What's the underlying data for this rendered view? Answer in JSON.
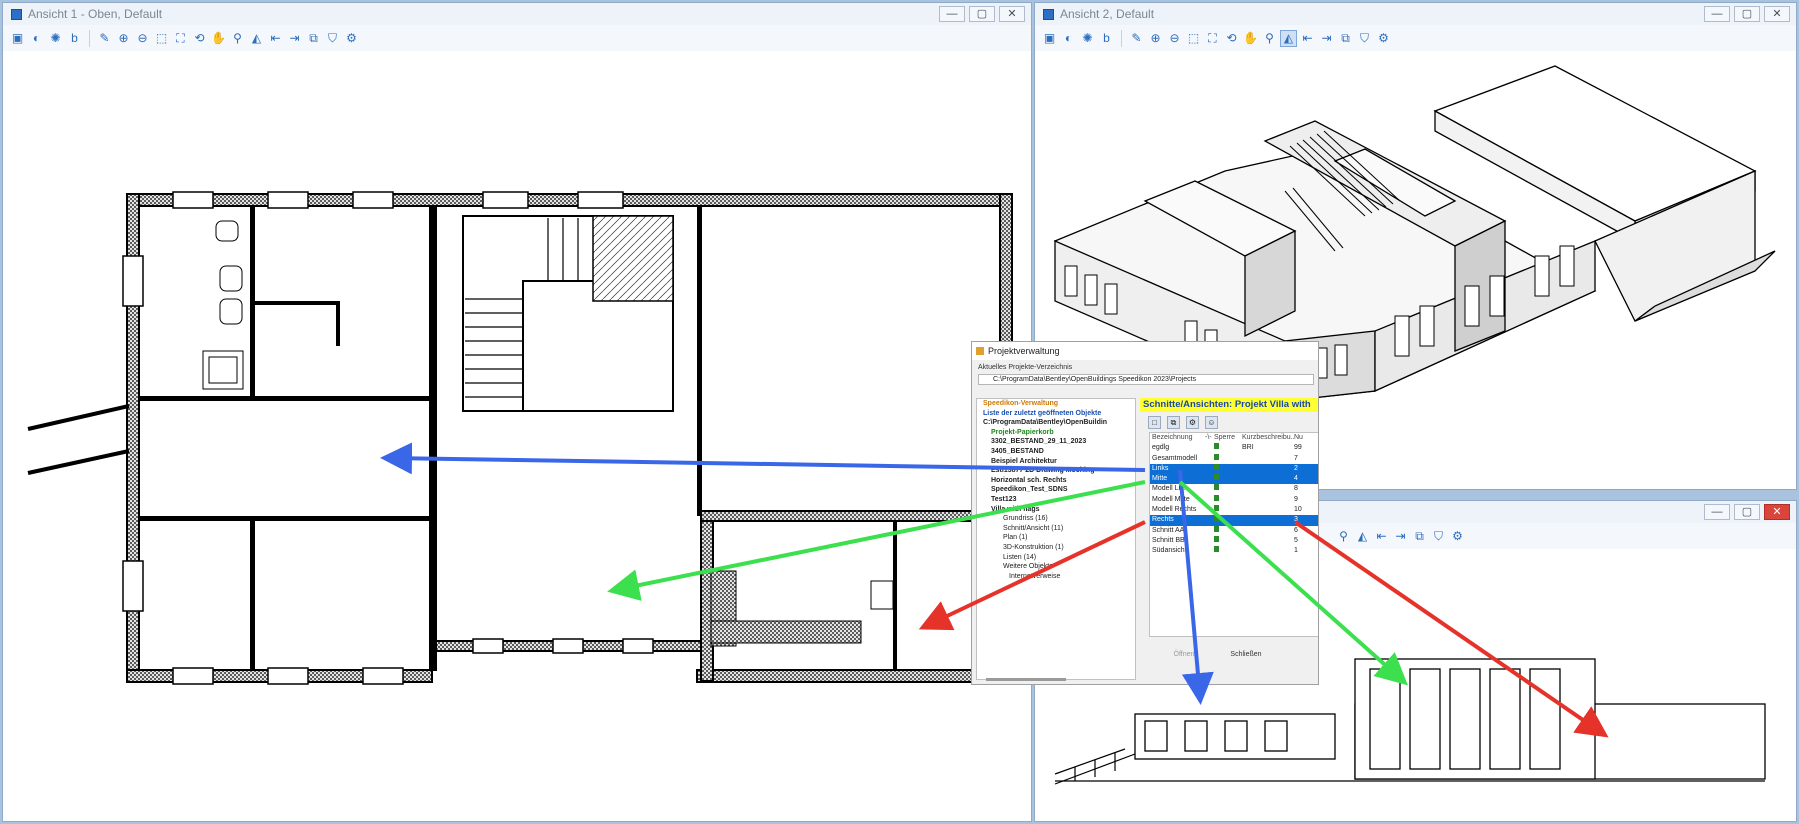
{
  "windows": [
    {
      "title": "Ansicht 1 - Oben, Default"
    },
    {
      "title": "Ansicht 2, Default"
    }
  ],
  "window_buttons": {
    "minimize": "—",
    "maximize": "▢",
    "close": "✕"
  },
  "dialog": {
    "title": "Projektverwaltung",
    "current_dir_label": "Aktuelles Projekte-Verzeichnis",
    "current_dir_path": "C:\\ProgramData\\Bentley\\OpenBuildings Speedikon 2023\\Projects",
    "tree": [
      {
        "label": "Speedikon-Verwaltung",
        "style": "orange"
      },
      {
        "label": "Liste der zuletzt geöffneten Objekte",
        "style": "blue"
      },
      {
        "label": "C:\\ProgramData\\Bentley\\OpenBuildin",
        "style": "bold"
      },
      {
        "label": "Projekt-Papierkorb",
        "style": "green"
      },
      {
        "label": "3302_BESTAND_29_11_2023",
        "style": "bold"
      },
      {
        "label": "3405_BESTAND",
        "style": "bold"
      },
      {
        "label": "Beispiel Architektur",
        "style": "bold"
      },
      {
        "label": "Esti13877 2D Drawing Moching",
        "style": "bold"
      },
      {
        "label": "Horizontal sch. Rechts",
        "style": "bold"
      },
      {
        "label": "Speedikon_Test_SDNS",
        "style": "bold"
      },
      {
        "label": "Test123",
        "style": "bold"
      },
      {
        "label": "Villa with flags",
        "style": "bold"
      },
      {
        "label": "Grundriss (16)",
        "style": "normal"
      },
      {
        "label": "Schnitt/Ansicht (11)",
        "style": "normal"
      },
      {
        "label": "Plan (1)",
        "style": "normal"
      },
      {
        "label": "3D-Konstruktion (1)",
        "style": "normal"
      },
      {
        "label": "Listen (14)",
        "style": "normal"
      },
      {
        "label": "Weitere Objekte",
        "style": "normal"
      },
      {
        "label": "Internetverweise",
        "style": "normal"
      }
    ],
    "subpanel": {
      "title": "Schnitte/Ansichten: Projekt Villa with",
      "columns": [
        "Bezeichnung",
        "-\\-",
        "Sperre",
        "Kurzbeschreibu...",
        "Nu"
      ],
      "rows": [
        {
          "name": "egdlg",
          "desc": "BRI",
          "num": "99",
          "selected": false
        },
        {
          "name": "Gesamtmodell",
          "desc": "",
          "num": "7",
          "selected": false
        },
        {
          "name": "Links",
          "desc": "",
          "num": "2",
          "selected": true
        },
        {
          "name": "Mitte",
          "desc": "",
          "num": "4",
          "selected": true
        },
        {
          "name": "Modell Li...",
          "desc": "",
          "num": "8",
          "selected": false
        },
        {
          "name": "Modell Mitte",
          "desc": "",
          "num": "9",
          "selected": false
        },
        {
          "name": "Modell Rechts",
          "desc": "",
          "num": "10",
          "selected": false
        },
        {
          "name": "Rechts",
          "desc": "",
          "num": "3",
          "selected": true
        },
        {
          "name": "Schnitt AA",
          "desc": "",
          "num": "6",
          "selected": false
        },
        {
          "name": "Schnitt BB",
          "desc": "",
          "num": "5",
          "selected": false
        },
        {
          "name": "Südansicht",
          "desc": "",
          "num": "1",
          "selected": false
        }
      ],
      "open_button": "Öffnen",
      "close_button": "Schließen"
    }
  },
  "colors": {
    "arrow_blue": "#3a66e8",
    "arrow_green": "#3ce04e",
    "arrow_red": "#e6332a",
    "selection": "#0d6fd6"
  }
}
